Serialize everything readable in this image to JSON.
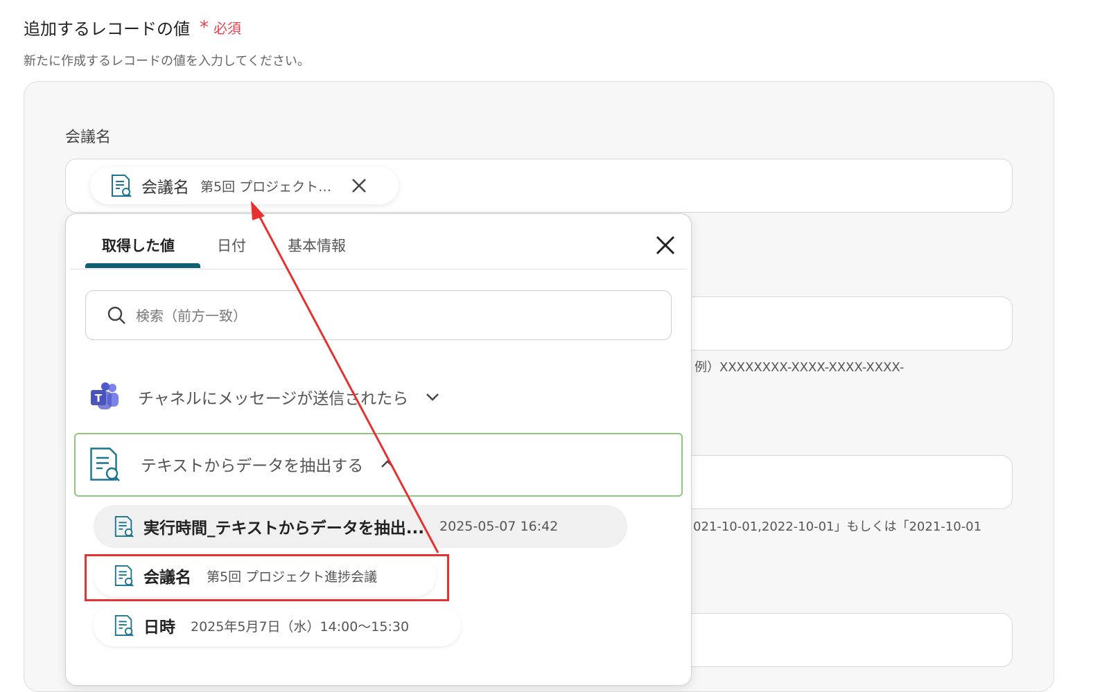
{
  "section": {
    "title": "追加するレコードの値",
    "required_star": "*",
    "required_label": "必須",
    "description": "新たに作成するレコードの値を入力してください。"
  },
  "field": {
    "label": "会議名",
    "chip": {
      "key": "会議名",
      "value": "第5回 プロジェクト…",
      "icon": "document-search-icon"
    }
  },
  "hints": {
    "uuid_example": "例）XXXXXXXX-XXXX-XXXX-XXXX-",
    "date_example": "021-10-01,2022-10-01」もしくは「2021-10-01"
  },
  "dropdown": {
    "tabs": [
      {
        "label": "取得した値",
        "active": true
      },
      {
        "label": "日付",
        "active": false
      },
      {
        "label": "基本情報",
        "active": false
      }
    ],
    "search_placeholder": "検索（前方一致）",
    "groups": [
      {
        "label": "チャネルにメッセージが送信されたら",
        "icon": "teams-icon",
        "expanded": false
      },
      {
        "label": "テキストからデータを抽出する",
        "icon": "document-search-icon",
        "expanded": true
      }
    ],
    "items": [
      {
        "key": "実行時間_テキストからデータを抽出...",
        "value": "2025-05-07 16:42"
      },
      {
        "key": "会議名",
        "value": "第5回 プロジェクト進捗会議"
      },
      {
        "key": "日時",
        "value": "2025年5月7日（水）14:00〜15:30"
      }
    ]
  },
  "colors": {
    "required": "#e8414b",
    "active_tab": "#0e5f73",
    "group_highlight": "#8cc97a",
    "annotation": "#e53131"
  }
}
